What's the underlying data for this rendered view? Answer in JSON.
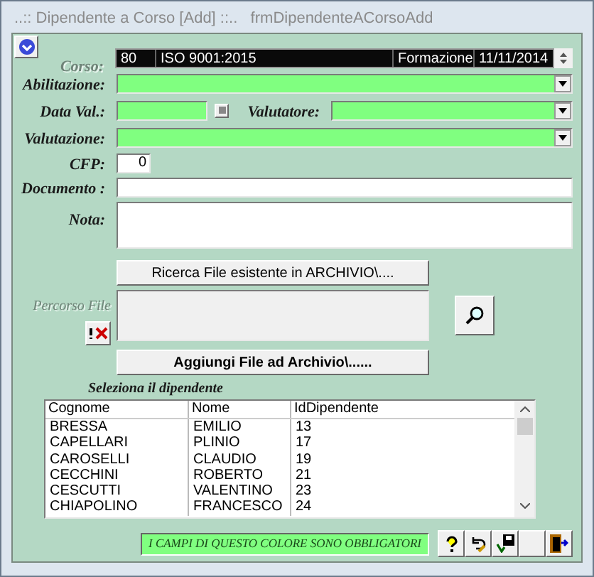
{
  "window": {
    "title": "..:: Dipendente a Corso [Add] ::..   frmDipendenteACorsoAdd"
  },
  "corso": {
    "label": "Corso:",
    "disabled": true,
    "cells": [
      "80",
      "ISO 9001:2015",
      "Formazione",
      "11/11/2014"
    ]
  },
  "fields": [
    {
      "kind": "combo",
      "label": "Abilitazione:",
      "required": true
    },
    {
      "kind": "date",
      "label": "Data Val.:",
      "required": true,
      "second_label": "Valutatore:"
    },
    {
      "kind": "combo",
      "label": "Valutazione:",
      "required": true
    },
    {
      "kind": "number",
      "label": "CFP:",
      "required": false,
      "value": "0"
    },
    {
      "kind": "text",
      "label": "Documento :",
      "required": false
    },
    {
      "kind": "memo",
      "label": "Nota:",
      "required": false
    }
  ],
  "file": {
    "search_button": "Ricerca File esistente in ARCHIVIO\\....",
    "path_label": "Percorso File",
    "path_disabled": true,
    "add_button": "Aggiungi File ad Archivio\\......"
  },
  "table": {
    "title": "Seleziona il dipendente",
    "columns": [
      "Cognome",
      "Nome",
      "IdDipendente"
    ],
    "rows": [
      [
        "BRESSA",
        "EMILIO",
        "13"
      ],
      [
        "CAPELLARI",
        "PLINIO",
        "17"
      ],
      [
        "CAROSELLI",
        "CLAUDIO",
        "19"
      ],
      [
        "CECCHINI",
        "ROBERTO",
        "21"
      ],
      [
        "CESCUTTI",
        "VALENTINO",
        "23"
      ],
      [
        "CHIAPOLINO",
        "FRANCESCO",
        "24"
      ]
    ]
  },
  "notice": "I CAMPI DI QUESTO COLORE SONO OBBLIGATORI"
}
